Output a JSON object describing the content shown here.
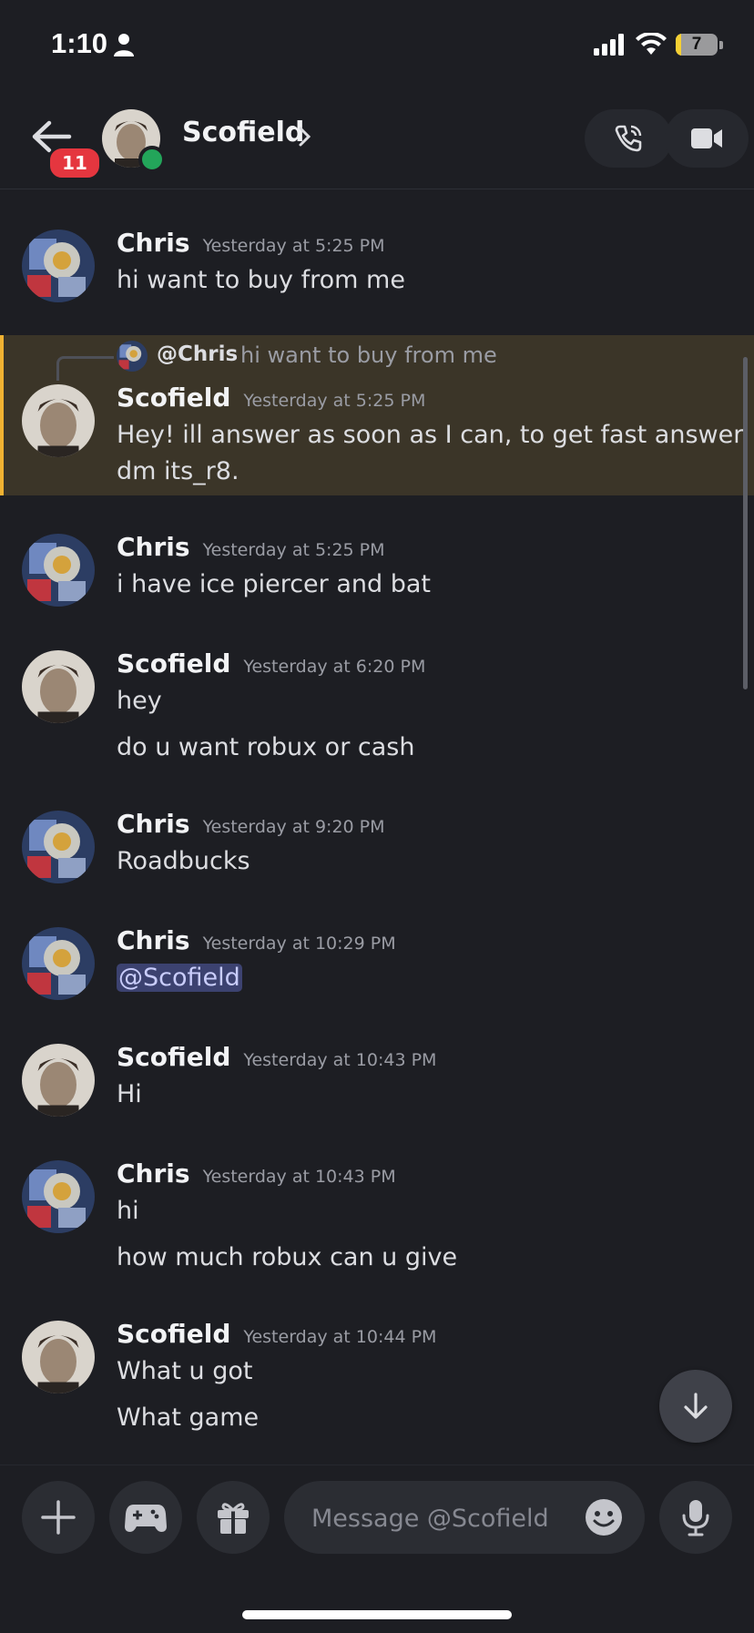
{
  "status_bar": {
    "time": "1:10",
    "battery": "7"
  },
  "header": {
    "back_badge": "11",
    "title": "Scofield"
  },
  "messages": [
    {
      "author": "Chris",
      "timestamp": "Yesterday at 5:25 PM",
      "lines": [
        "hi want to buy from me"
      ]
    },
    {
      "author": "Scofield",
      "timestamp": "Yesterday at 5:25 PM",
      "reply": {
        "author": "@Chris",
        "text": "hi want to buy from me"
      },
      "lines": [
        "Hey! ill answer as soon as I can, to get fast answer",
        "dm its_r8."
      ]
    },
    {
      "author": "Chris",
      "timestamp": "Yesterday at 5:25 PM",
      "lines": [
        "i have ice piercer and bat"
      ]
    },
    {
      "author": "Scofield",
      "timestamp": "Yesterday at 6:20 PM",
      "lines": [
        "hey",
        "do u want robux or cash"
      ]
    },
    {
      "author": "Chris",
      "timestamp": "Yesterday at 9:20 PM",
      "lines": [
        "Roadbucks"
      ]
    },
    {
      "author": "Chris",
      "timestamp": "Yesterday at 10:29 PM",
      "lines": [
        "@Scofield"
      ]
    },
    {
      "author": "Scofield",
      "timestamp": "Yesterday at 10:43 PM",
      "lines": [
        "Hi"
      ]
    },
    {
      "author": "Chris",
      "timestamp": "Yesterday at 10:43 PM",
      "lines": [
        "hi",
        "how much robux can u give"
      ]
    },
    {
      "author": "Scofield",
      "timestamp": "Yesterday at 10:44 PM",
      "lines": [
        "What u got",
        "What game"
      ]
    }
  ],
  "composer": {
    "placeholder": "Message @Scofield"
  },
  "colors": {
    "background": "#1d1e23",
    "highlight": "#3b3528",
    "highlight_border": "#f0b232",
    "badge": "#e5363f",
    "online": "#23a55a",
    "mention_bg": "#3c4270"
  }
}
